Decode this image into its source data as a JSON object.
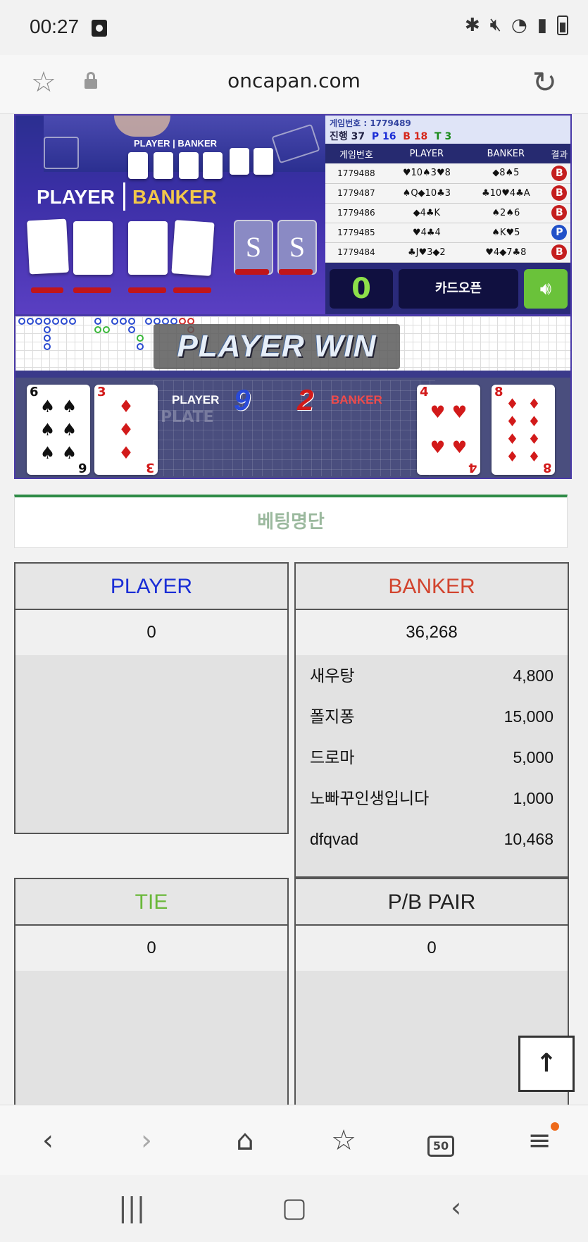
{
  "status_bar": {
    "time": "00:27"
  },
  "browser": {
    "url": "oncapan.com"
  },
  "video": {
    "label_player": "PLAYER",
    "label_banker": "BANKER",
    "shoe_letter": "S"
  },
  "score_panel": {
    "header_game_no": "게임번호 : 1779489",
    "progress": "진행 37",
    "p_count": "P 16",
    "b_count": "B 18",
    "t_count": "T 3",
    "legend_player": "PLAYER",
    "legend_banker": "BANKER",
    "columns": [
      "게임번호",
      "PLAYER",
      "BANKER",
      "결과"
    ],
    "rows": [
      {
        "game": "1779488",
        "player": "♥10♠3♥8",
        "banker": "◆8♠5",
        "result": "B"
      },
      {
        "game": "1779487",
        "player": "♠Q◆10♣3",
        "banker": "♣10♥4♣A",
        "result": "B"
      },
      {
        "game": "1779486",
        "player": "◆4♣K",
        "banker": "♠2♠6",
        "result": "B"
      },
      {
        "game": "1779485",
        "player": "♥4♣4",
        "banker": "♠K♥5",
        "result": "P"
      },
      {
        "game": "1779484",
        "player": "♣J♥3◆2",
        "banker": "♥4◆7♣8",
        "result": "B"
      }
    ],
    "counter": "0",
    "card_open_label": "카드오픈"
  },
  "win_banner": "PLAYER WIN",
  "result_strip": {
    "player_label": "PLAYER",
    "player_score": "9",
    "banker_label": "BANKER",
    "banker_score": "2",
    "watermark": "PLATE",
    "cards": [
      {
        "rank": "6",
        "suit": "♠",
        "color": "black"
      },
      {
        "rank": "3",
        "suit": "♦",
        "color": "red"
      },
      {
        "rank": "4",
        "suit": "♥",
        "color": "red"
      },
      {
        "rank": "8",
        "suit": "♦",
        "color": "red"
      }
    ]
  },
  "betting": {
    "section_title": "베팅명단",
    "player": {
      "title": "PLAYER",
      "total": "0"
    },
    "banker": {
      "title": "BANKER",
      "total": "36,268",
      "entries": [
        {
          "name": "새우탕",
          "amount": "4,800"
        },
        {
          "name": "폴지퐁",
          "amount": "15,000"
        },
        {
          "name": "드로마",
          "amount": "5,000"
        },
        {
          "name": "노빠꾸인생입니다",
          "amount": "1,000"
        },
        {
          "name": "dfqvad",
          "amount": "10,468"
        }
      ]
    },
    "tie": {
      "title": "TIE",
      "total": "0"
    },
    "pair": {
      "title": "P/B PAIR",
      "total": "0"
    }
  },
  "toolbar": {
    "tabs_count": "50"
  },
  "colors": {
    "player_blue": "#1a2ed6",
    "banker_red": "#d2442e",
    "tie_green": "#6ab83a",
    "accent_green": "#2e8b46"
  }
}
